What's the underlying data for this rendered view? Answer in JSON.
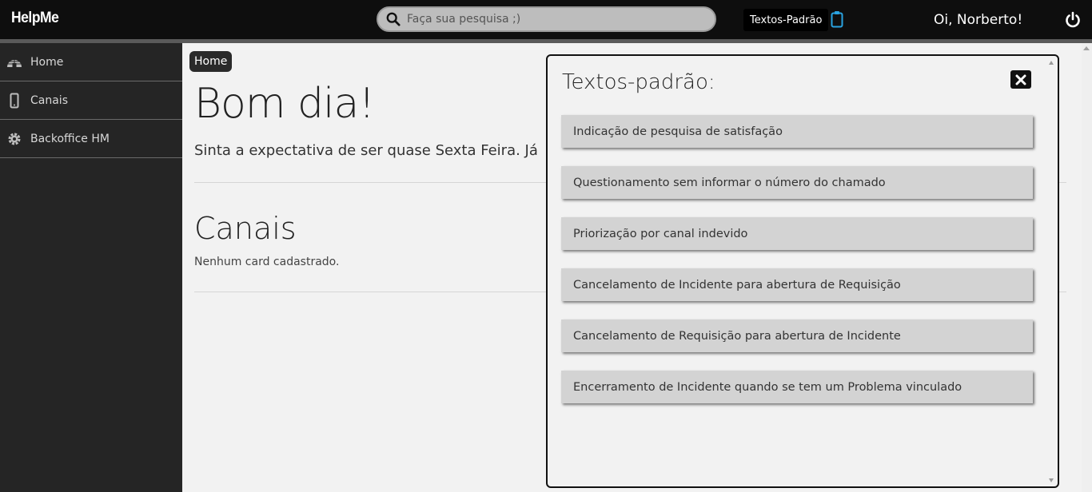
{
  "header": {
    "logo": "HelpMe",
    "search_placeholder": "Faça sua pesquisa ;)",
    "textos_padrao_button": "Textos-Padrão",
    "greeting": "Oi, Norberto!"
  },
  "sidebar": {
    "items": [
      {
        "label": "Home",
        "icon": "igloo-icon"
      },
      {
        "label": "Canais",
        "icon": "mobile-icon"
      },
      {
        "label": "Backoffice HM",
        "icon": "gear-icon"
      }
    ]
  },
  "main": {
    "breadcrumb": "Home",
    "greeting_title": "Bom dia!",
    "subtitle": "Sinta a expectativa de ser quase Sexta Feira. Já",
    "section_title": "Canais",
    "empty_message": "Nenhum card cadastrado."
  },
  "modal": {
    "title": "Textos-padrão:",
    "items": [
      "Indicação de pesquisa de satisfação",
      "Questionamento sem informar o número do chamado",
      "Priorização por canal indevido",
      "Cancelamento de Incidente para abertura de Requisição",
      "Cancelamento de Requisição para abertura de Incidente",
      "Encerramento de Incidente quando se tem um Problema vinculado"
    ]
  },
  "colors": {
    "topbar": "#0e0e0e",
    "sidebar": "#252525",
    "accent_clipboard": "#29a3e0",
    "item_bg": "#d3d3d3"
  }
}
